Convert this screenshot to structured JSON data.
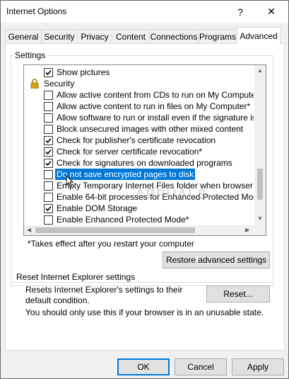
{
  "window": {
    "title": "Internet Options",
    "help_glyph": "?",
    "close_glyph": "✕"
  },
  "tabs": [
    {
      "label": "General"
    },
    {
      "label": "Security"
    },
    {
      "label": "Privacy"
    },
    {
      "label": "Content"
    },
    {
      "label": "Connections"
    },
    {
      "label": "Programs"
    },
    {
      "label": "Advanced",
      "active": true
    }
  ],
  "settings": {
    "group_label": "Settings",
    "rows": [
      {
        "type": "option",
        "label": "Show pictures",
        "checked": true
      },
      {
        "type": "category",
        "label": "Security",
        "icon": "lock-icon"
      },
      {
        "type": "option",
        "label": "Allow active content from CDs to run on My Computer*",
        "checked": false
      },
      {
        "type": "option",
        "label": "Allow active content to run in files on My Computer*",
        "checked": false
      },
      {
        "type": "option",
        "label": "Allow software to run or install even if the signature is inva",
        "checked": false
      },
      {
        "type": "option",
        "label": "Block unsecured images with other mixed content",
        "checked": false
      },
      {
        "type": "option",
        "label": "Check for publisher's certificate revocation",
        "checked": true
      },
      {
        "type": "option",
        "label": "Check for server certificate revocation*",
        "checked": true
      },
      {
        "type": "option",
        "label": "Check for signatures on downloaded programs",
        "checked": true
      },
      {
        "type": "option",
        "label": "Do not save encrypted pages to disk",
        "checked": false,
        "selected": true
      },
      {
        "type": "option",
        "label": "Empty Temporary Internet Files folder when browser is clo",
        "checked": false
      },
      {
        "type": "option",
        "label": "Enable 64-bit processes for Enhanced Protected Mode*",
        "checked": false
      },
      {
        "type": "option",
        "label": "Enable DOM Storage",
        "checked": true
      },
      {
        "type": "option",
        "label": "Enable Enhanced Protected Mode*",
        "checked": false
      }
    ],
    "footnote": "*Takes effect after you restart your computer",
    "restore_button": "Restore advanced settings"
  },
  "reset": {
    "group_label": "Reset Internet Explorer settings",
    "description": "Resets Internet Explorer's settings to their default condition.",
    "reset_button": "Reset...",
    "warning": "You should only use this if your browser is in an unusable state."
  },
  "footer": {
    "ok": "OK",
    "cancel": "Cancel",
    "apply": "Apply"
  },
  "colors": {
    "selection": "#0078d7",
    "lock_icon": "#d4a017"
  },
  "watermark": "APPUALS"
}
